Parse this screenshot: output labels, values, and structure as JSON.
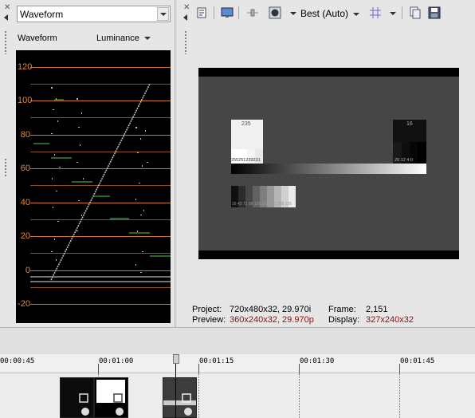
{
  "scopes": {
    "scope_type": "Waveform",
    "scope_label": "Waveform",
    "channel": "Luminance",
    "y_labels": [
      "120",
      "100",
      "80",
      "60",
      "40",
      "20",
      "0",
      "-20"
    ]
  },
  "preview": {
    "quality": "Best (Auto)",
    "chart": {
      "patch_top_label": "235",
      "patch_top_values": "255251239231",
      "patch_right_label": "16",
      "patch_right_values": "20 12  4  0",
      "steps_values": "16 43 71 98 126 153 181 208 235"
    },
    "info": {
      "project_label": "Project:",
      "project_value": "720x480x32, 29.970i",
      "preview_label": "Preview:",
      "preview_value": "360x240x32, 29.970p",
      "frame_label": "Frame:",
      "frame_value": "2,151",
      "display_label": "Display:",
      "display_value": "327x240x32"
    }
  },
  "timeline": {
    "ticks": [
      "00:00:45",
      "00:01:00",
      "00:01:15",
      "00:01:30",
      "00:01:45"
    ]
  },
  "colors": {
    "graticule": "#c8742a",
    "info_red": "#8b1010"
  }
}
